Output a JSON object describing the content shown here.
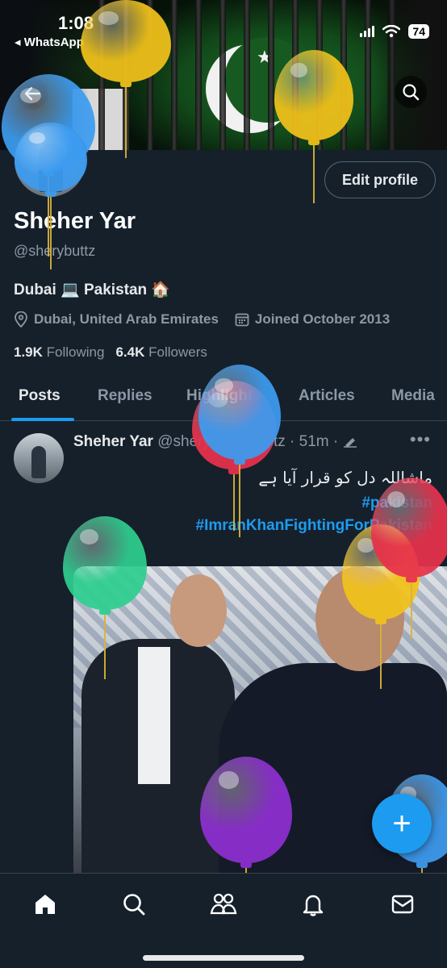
{
  "status_bar": {
    "time": "1:08",
    "back_app": "◂ WhatsApp",
    "battery": "74"
  },
  "profile": {
    "name": "Sheher Yar",
    "handle": "@sherybuttz",
    "bio": "Dubai 💻 Pakistan 🏠",
    "location": "Dubai, United Arab Emirates",
    "joined": "Joined October 2013",
    "following_count": "1.9K",
    "following_label": "Following",
    "followers_count": "6.4K",
    "followers_label": "Followers",
    "edit_button": "Edit profile"
  },
  "tabs": [
    {
      "label": "Posts",
      "active": true
    },
    {
      "label": "Replies",
      "active": false
    },
    {
      "label": "Highlights",
      "active": false
    },
    {
      "label": "Articles",
      "active": false
    },
    {
      "label": "Media",
      "active": false
    }
  ],
  "post": {
    "author": "Sheher Yar",
    "handle_partial": "@shery",
    "handle_tail": "tz",
    "time": "· 51m ·",
    "text_urdu": "ماشاللہ دل کو قرار آیا ہے",
    "hashtag1_visible": "#pa",
    "hashtag1_tail": "kistan",
    "hashtag2_visible": "#ImranKhanFightingForP",
    "hashtag2_tail": "akistan"
  },
  "icons": {
    "back": "arrow-left-icon",
    "search_top": "search-icon",
    "location": "location-pin-icon",
    "calendar": "calendar-icon",
    "edit": "pencil-icon",
    "more": "more-dots-icon",
    "compose": "plus-icon",
    "nav": [
      "home-icon",
      "search-icon",
      "communities-icon",
      "notifications-icon",
      "messages-icon"
    ]
  },
  "colors": {
    "background": "#15202b",
    "accent": "#1d9bf0",
    "muted": "#8b98a5",
    "balloons": [
      "#3d9cf0",
      "#f2c21a",
      "#e8324d",
      "#2ecf8f",
      "#8e2fd1"
    ]
  }
}
